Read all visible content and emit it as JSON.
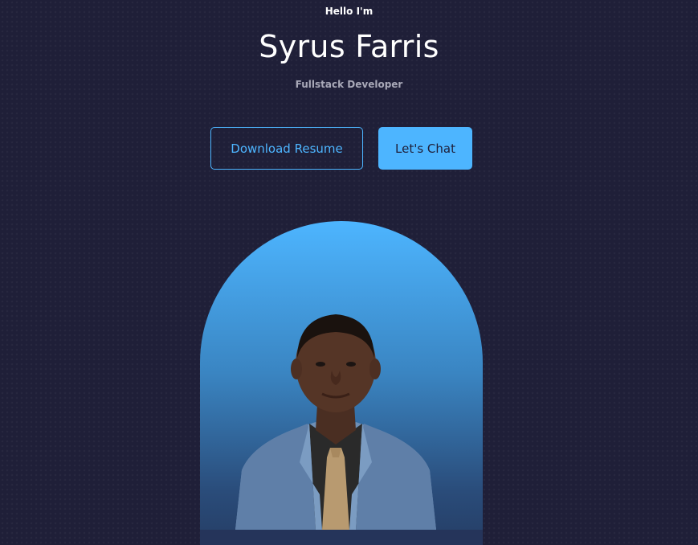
{
  "header": {
    "greeting": "Hello I'm",
    "name": "Syrus Farris",
    "role": "Fullstack Developer"
  },
  "cta": {
    "download_label": "Download Resume",
    "chat_label": "Let's Chat"
  },
  "colors": {
    "background": "#1f1f38",
    "accent": "#4db5ff",
    "muted_text": "#a9a9b8"
  }
}
